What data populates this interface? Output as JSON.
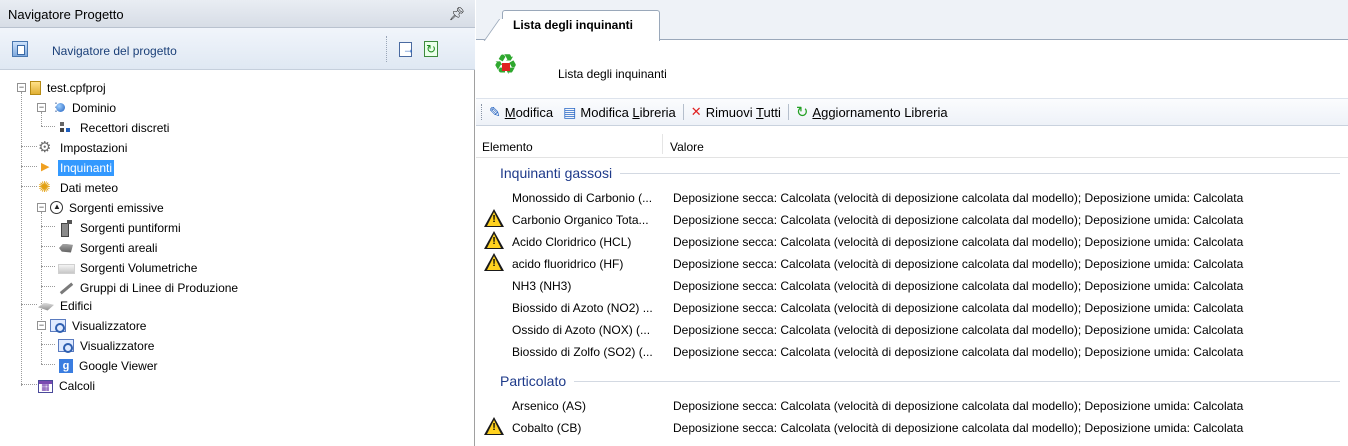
{
  "navigator": {
    "title": "Navigatore Progetto",
    "header_label": "Navigatore del progetto",
    "tree": {
      "project": "test.cpfproj",
      "dominio": "Dominio",
      "recettori": "Recettori discreti",
      "impostazioni": "Impostazioni",
      "inquinanti": "Inquinanti",
      "dati_meteo": "Dati meteo",
      "sorgenti": "Sorgenti emissive",
      "puntiformi": "Sorgenti puntiformi",
      "areali": "Sorgenti areali",
      "volumetriche": "Sorgenti Volumetriche",
      "gruppi": "Gruppi di Linee di Produzione",
      "edifici": "Edifici",
      "visualizzatore": "Visualizzatore",
      "visualizzatore_child": "Visualizzatore",
      "google_viewer": "Google Viewer",
      "calcoli": "Calcoli"
    }
  },
  "right_panel": {
    "tab_label": "Lista degli inquinanti",
    "panel_title": "Lista degli inquinanti",
    "toolbar": {
      "modifica": {
        "u": "M",
        "rest": "odifica"
      },
      "modifica_libreria": {
        "pre": "Modifica ",
        "u": "L",
        "rest": "ibreria"
      },
      "rimuovi": {
        "pre": "Rimuovi ",
        "u": "T",
        "rest": "utti"
      },
      "aggiornamento": {
        "u": "A",
        "rest": "ggiornamento Libreria"
      }
    },
    "columns": {
      "elemento": "Elemento",
      "valore": "Valore"
    },
    "groups": {
      "gassosi": {
        "title": "Inquinanti gassosi",
        "rows": [
          {
            "name": "Monossido di Carbonio (...",
            "value": "Deposizione secca: Calcolata (velocità di deposizione calcolata dal modello); Deposizione umida: Calcolata",
            "warning": false
          },
          {
            "name": "Carbonio Organico Tota...",
            "value": "Deposizione secca: Calcolata (velocità di deposizione calcolata dal modello); Deposizione umida: Calcolata",
            "warning": true
          },
          {
            "name": "Acido Cloridrico (HCL)",
            "value": "Deposizione secca: Calcolata (velocità di deposizione calcolata dal modello); Deposizione umida: Calcolata",
            "warning": true
          },
          {
            "name": "acido fluoridrico (HF)",
            "value": "Deposizione secca: Calcolata (velocità di deposizione calcolata dal modello); Deposizione umida: Calcolata",
            "warning": true
          },
          {
            "name": "NH3 (NH3)",
            "value": "Deposizione secca: Calcolata (velocità di deposizione calcolata dal modello); Deposizione umida: Calcolata",
            "warning": false
          },
          {
            "name": "Biossido di Azoto (NO2) ...",
            "value": "Deposizione secca: Calcolata (velocità di deposizione calcolata dal modello); Deposizione umida: Calcolata",
            "warning": false
          },
          {
            "name": "Ossido di Azoto (NOX) (...",
            "value": "Deposizione secca: Calcolata (velocità di deposizione calcolata dal modello); Deposizione umida: Calcolata",
            "warning": false
          },
          {
            "name": "Biossido di Zolfo (SO2) (...",
            "value": "Deposizione secca: Calcolata (velocità di deposizione calcolata dal modello); Deposizione umida: Calcolata",
            "warning": false
          }
        ]
      },
      "particolato": {
        "title": "Particolato",
        "rows": [
          {
            "name": "Arsenico (AS)",
            "value": "Deposizione secca: Calcolata (velocità di deposizione calcolata dal modello); Deposizione umida: Calcolata",
            "warning": false
          },
          {
            "name": "Cobalto (CB)",
            "value": "Deposizione secca: Calcolata (velocità di deposizione calcolata dal modello); Deposizione umida: Calcolata",
            "warning": true
          }
        ]
      }
    }
  }
}
